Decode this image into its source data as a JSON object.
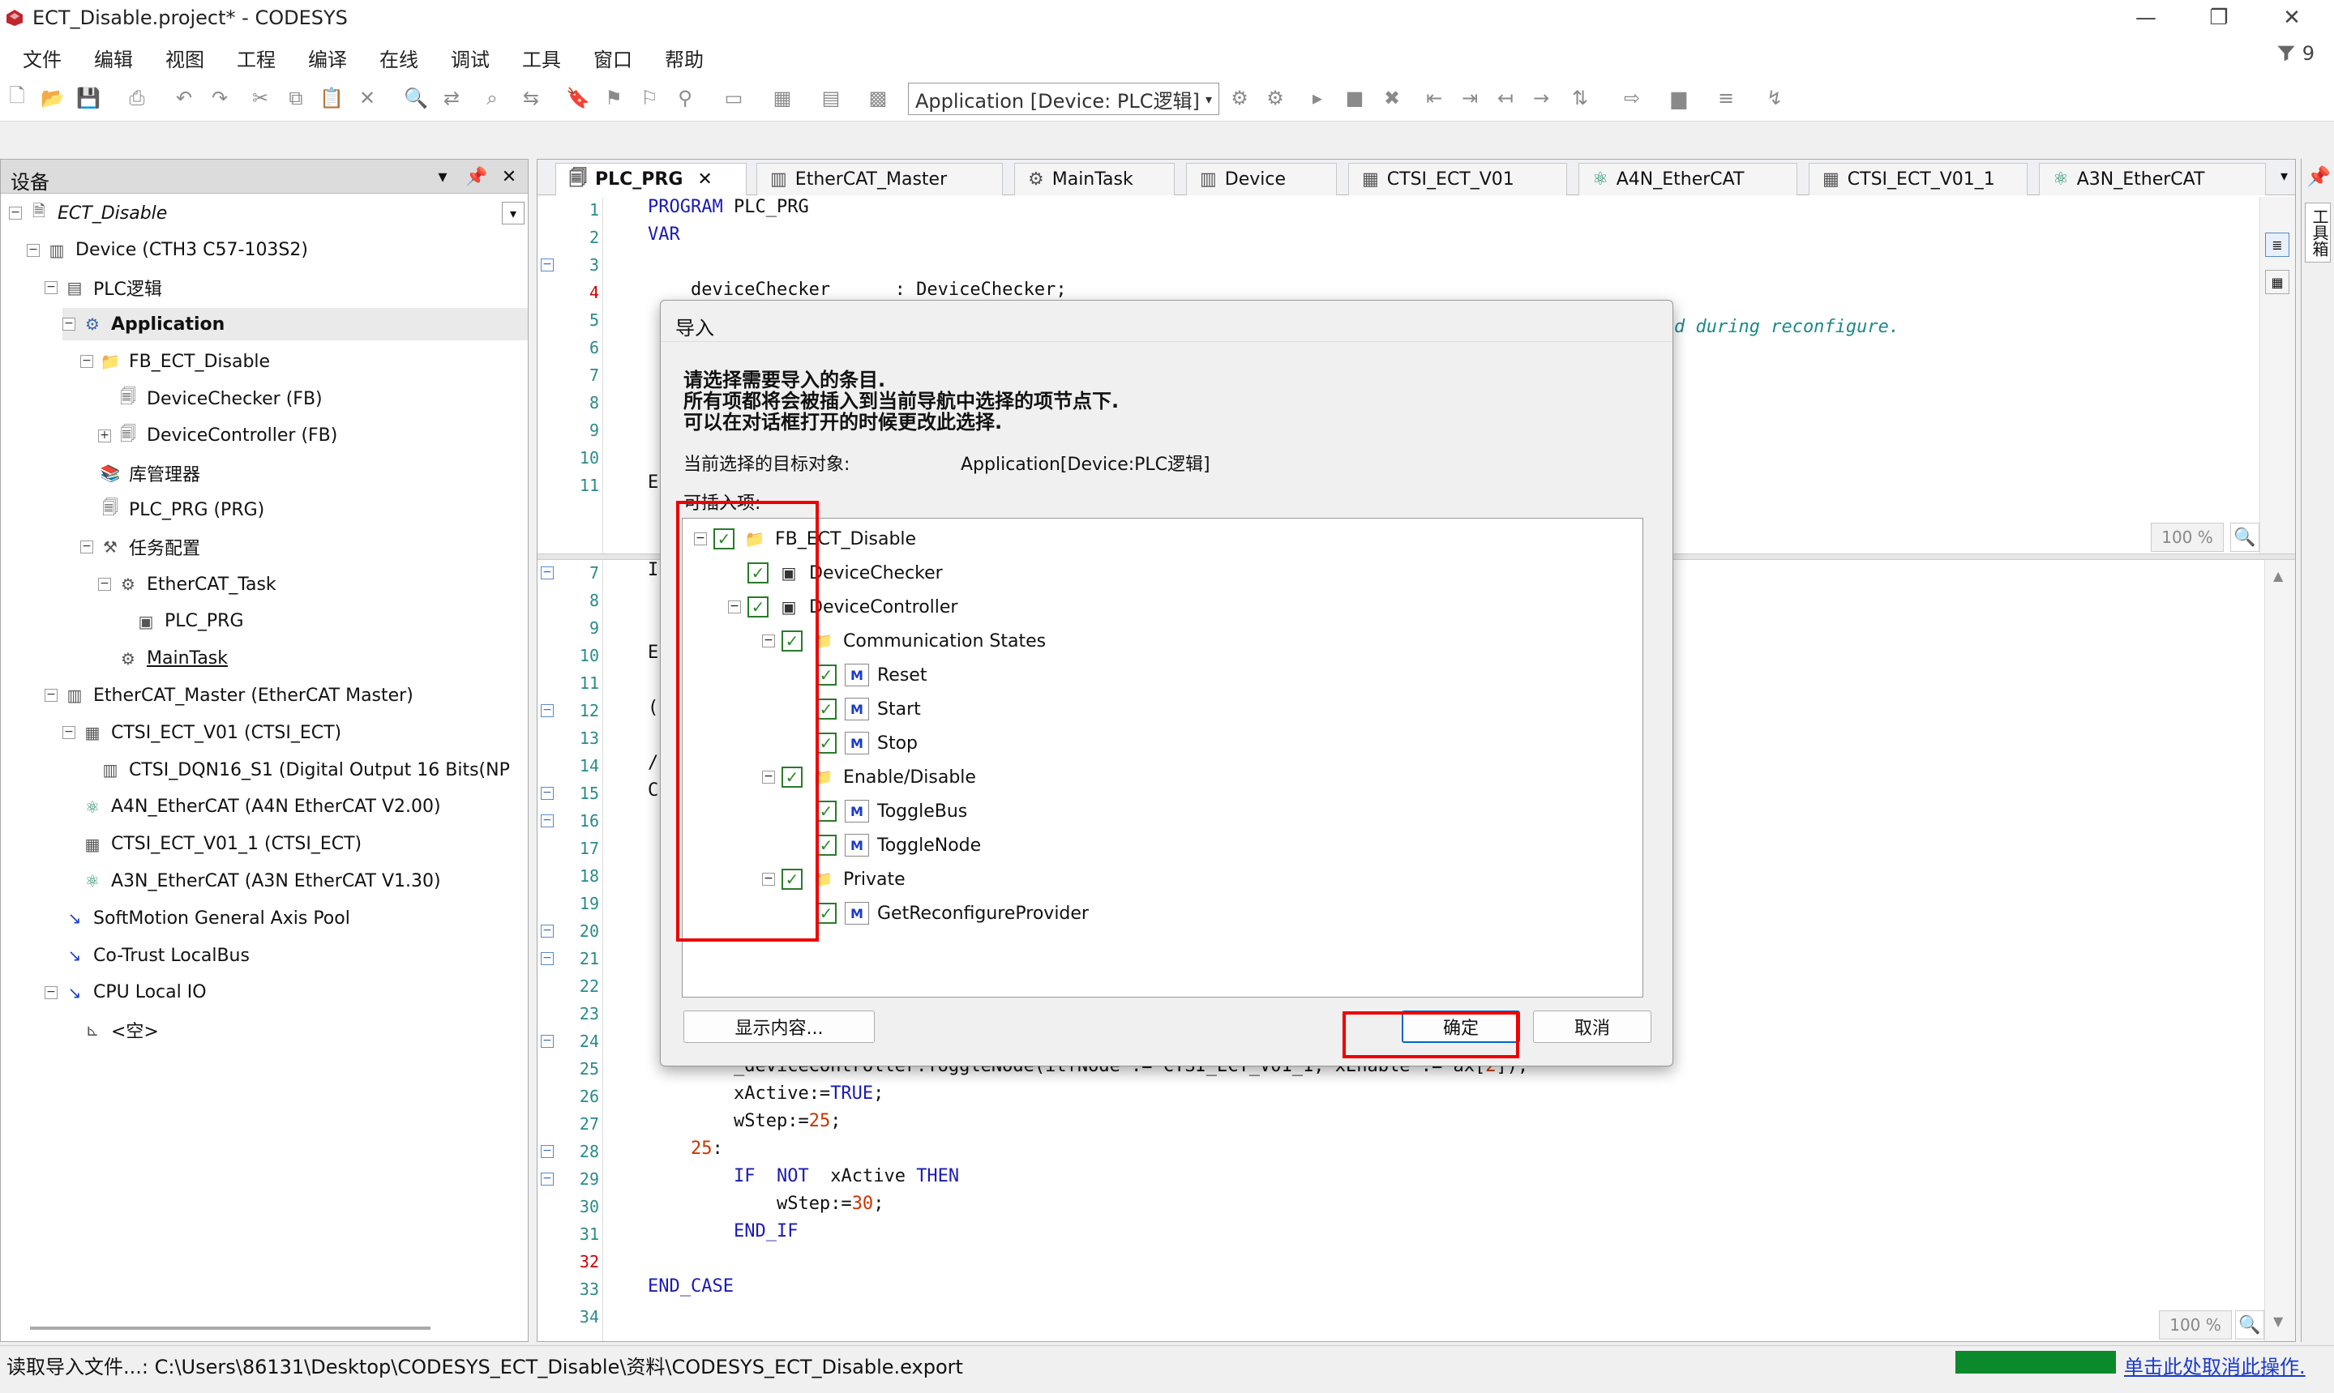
{
  "window": {
    "title": "ECT_Disable.project* - CODESYS",
    "minimize": "—",
    "restore": "❐",
    "close": "✕"
  },
  "menu": [
    "文件",
    "编辑",
    "视图",
    "工程",
    "编译",
    "在线",
    "调试",
    "工具",
    "窗口",
    "帮助"
  ],
  "filter_count": "9",
  "toolbar": {
    "application_select": "Application [Device: PLC逻辑]"
  },
  "device_panel": {
    "title": "设备",
    "tree": [
      {
        "label": "ECT_Disable",
        "style": "italic",
        "icon": "project-icon",
        "level": 0,
        "expander": "−"
      },
      {
        "label": "Device (CTH3 C57-103S2)",
        "icon": "device-icon",
        "level": 1,
        "expander": "−"
      },
      {
        "label": "PLC逻辑",
        "icon": "plc-logic-icon",
        "level": 2,
        "expander": "−"
      },
      {
        "label": "Application",
        "style": "bold",
        "icon": "application-gear-icon",
        "level": 3,
        "expander": "−",
        "selected": true
      },
      {
        "label": "FB_ECT_Disable",
        "icon": "folder-icon",
        "level": 4,
        "expander": "−"
      },
      {
        "label": "DeviceChecker (FB)",
        "icon": "pou-icon",
        "level": 5,
        "expander": ""
      },
      {
        "label": "DeviceController (FB)",
        "icon": "pou-icon",
        "level": 5,
        "expander": "+"
      },
      {
        "label": "库管理器",
        "icon": "library-icon",
        "level": 4,
        "expander": ""
      },
      {
        "label": "PLC_PRG (PRG)",
        "icon": "pou-icon",
        "level": 4,
        "expander": ""
      },
      {
        "label": "任务配置",
        "icon": "task-config-icon",
        "level": 4,
        "expander": "−"
      },
      {
        "label": "EtherCAT_Task",
        "icon": "task-icon",
        "level": 5,
        "expander": "−"
      },
      {
        "label": "PLC_PRG",
        "icon": "program-call-icon",
        "level": 6,
        "expander": ""
      },
      {
        "label": "MainTask",
        "icon": "task-icon",
        "level": 5,
        "expander": "",
        "underline": true
      },
      {
        "label": "EtherCAT_Master (EtherCAT Master)",
        "icon": "ethercat-master-icon",
        "level": 2,
        "expander": "−"
      },
      {
        "label": "CTSI_ECT_V01 (CTSI_ECT)",
        "icon": "io-module-icon",
        "level": 3,
        "expander": "−"
      },
      {
        "label": "CTSI_DQN16_S1 (Digital Output 16 Bits(NP",
        "icon": "io-slice-icon",
        "level": 4,
        "expander": ""
      },
      {
        "label": "A4N_EtherCAT (A4N EtherCAT V2.00)",
        "icon": "drive-icon",
        "level": 3,
        "expander": ""
      },
      {
        "label": "CTSI_ECT_V01_1 (CTSI_ECT)",
        "icon": "io-module-icon",
        "level": 3,
        "expander": ""
      },
      {
        "label": "A3N_EtherCAT (A3N EtherCAT V1.30)",
        "icon": "drive-icon",
        "level": 3,
        "expander": ""
      },
      {
        "label": "SoftMotion General Axis Pool",
        "icon": "axis-pool-icon",
        "level": 2,
        "expander": ""
      },
      {
        "label": "Co-Trust LocalBus",
        "icon": "localbus-icon",
        "level": 2,
        "expander": ""
      },
      {
        "label": "CPU Local IO",
        "icon": "local-io-icon",
        "level": 2,
        "expander": "−"
      },
      {
        "label": "<空>",
        "icon": "empty-slot-icon",
        "level": 3,
        "expander": ""
      }
    ]
  },
  "editor": {
    "tabs": [
      {
        "label": "PLC_PRG",
        "active": true,
        "closable": true
      },
      {
        "label": "EtherCAT_Master"
      },
      {
        "label": "MainTask"
      },
      {
        "label": "Device"
      },
      {
        "label": "CTSI_ECT_V01"
      },
      {
        "label": "A4N_EtherCAT"
      },
      {
        "label": "CTSI_ECT_V01_1"
      },
      {
        "label": "A3N_EtherCAT"
      }
    ],
    "top_pane": {
      "lines": [
        {
          "n": "1",
          "text": "PROGRAM PLC_PRG"
        },
        {
          "n": "2",
          "text": "VAR"
        },
        {
          "n": "3",
          "text": ""
        },
        {
          "n": "4",
          "text": "    deviceChecker      : DeviceChecker;"
        },
        {
          "n": "5",
          "text": ""
        },
        {
          "n": "6",
          "text": ""
        },
        {
          "n": "7",
          "text": ""
        },
        {
          "n": "8",
          "text": ""
        },
        {
          "n": "9",
          "text": ""
        },
        {
          "n": "10",
          "text": ""
        },
        {
          "n": "11",
          "text": "E"
        }
      ],
      "comment_fragment": "d during reconfigure.",
      "zoom": "100 %"
    },
    "bottom_pane": {
      "lines": [
        {
          "n": "7",
          "text": "I"
        },
        {
          "n": "8",
          "text": ""
        },
        {
          "n": "9",
          "text": ""
        },
        {
          "n": "10",
          "text": "E"
        },
        {
          "n": "11",
          "text": ""
        },
        {
          "n": "12",
          "text": "("
        },
        {
          "n": "13",
          "text": ""
        },
        {
          "n": "14",
          "text": "/"
        },
        {
          "n": "15",
          "text": "C"
        },
        {
          "n": "16",
          "text": ""
        },
        {
          "n": "17",
          "text": ""
        },
        {
          "n": "18",
          "text": ""
        },
        {
          "n": "19",
          "text": ""
        },
        {
          "n": "20",
          "text": ""
        },
        {
          "n": "21",
          "text": ""
        },
        {
          "n": "22",
          "text": ""
        },
        {
          "n": "23",
          "text": ""
        },
        {
          "n": "24",
          "text": ""
        },
        {
          "n": "25",
          "text": "        _deviceController.ToggleNode(itfNode := CTSI_ECT_V01_1, xEnable := ax[2]);"
        },
        {
          "n": "26",
          "text": "        xActive:=TRUE;"
        },
        {
          "n": "27",
          "text": "        wStep:=25;"
        },
        {
          "n": "28",
          "text": "    25:"
        },
        {
          "n": "29",
          "text": "        IF  NOT  xActive THEN"
        },
        {
          "n": "30",
          "text": "            wStep:=30;"
        },
        {
          "n": "31",
          "text": "        END_IF"
        },
        {
          "n": "32",
          "text": ""
        },
        {
          "n": "33",
          "text": "END_CASE"
        },
        {
          "n": "34",
          "text": ""
        }
      ],
      "zoom": "100 %"
    }
  },
  "right_sidebar": {
    "label": "工具箱"
  },
  "status_bar": {
    "text": "读取导入文件...: C:\\Users\\86131\\Desktop\\CODESYS_ECT_Disable\\资料\\CODESYS_ECT_Disable.export",
    "progress": 1.0,
    "cancel_link": "单击此处取消此操作."
  },
  "dialog": {
    "title": "导入",
    "instructions": [
      "请选择需要导入的条目.",
      "所有项都将会被插入到当前导航中选择的项节点下.",
      "可以在对话框打开的时候更改此选择."
    ],
    "target_label": "当前选择的目标对象:",
    "target_value": "Application[Device:PLC逻辑]",
    "insertable_label": "可插入项:",
    "tree": [
      {
        "label": "FB_ECT_Disable",
        "icon": "folder-icon",
        "level": 0,
        "expander": "−",
        "checked": true
      },
      {
        "label": "DeviceChecker",
        "icon": "function-block-icon",
        "level": 1,
        "expander": "",
        "checked": true
      },
      {
        "label": "DeviceController",
        "icon": "function-block-icon",
        "level": 1,
        "expander": "−",
        "checked": true
      },
      {
        "label": "Communication States",
        "icon": "folder-icon",
        "level": 2,
        "expander": "−",
        "checked": true
      },
      {
        "label": "Reset",
        "icon": "method-icon",
        "level": 3,
        "expander": "",
        "checked": true
      },
      {
        "label": "Start",
        "icon": "method-icon",
        "level": 3,
        "expander": "",
        "checked": true
      },
      {
        "label": "Stop",
        "icon": "method-icon",
        "level": 3,
        "expander": "",
        "checked": true
      },
      {
        "label": "Enable/Disable",
        "icon": "folder-icon",
        "level": 2,
        "expander": "−",
        "checked": true
      },
      {
        "label": "ToggleBus",
        "icon": "method-icon",
        "level": 3,
        "expander": "",
        "checked": true
      },
      {
        "label": "ToggleNode",
        "icon": "method-icon",
        "level": 3,
        "expander": "",
        "checked": true
      },
      {
        "label": "Private",
        "icon": "folder-icon",
        "level": 2,
        "expander": "−",
        "checked": true
      },
      {
        "label": "GetReconfigureProvider",
        "icon": "method-icon",
        "level": 3,
        "expander": "",
        "checked": true
      }
    ],
    "show_content_button": "显示内容...",
    "ok_button": "确定",
    "cancel_button": "取消"
  },
  "colors": {
    "keyword": "#1b1bb3",
    "comment": "#1a8a8a",
    "highlight_box": "#e00000",
    "progress": "#0a8a2a",
    "link": "#1a3ac9"
  }
}
